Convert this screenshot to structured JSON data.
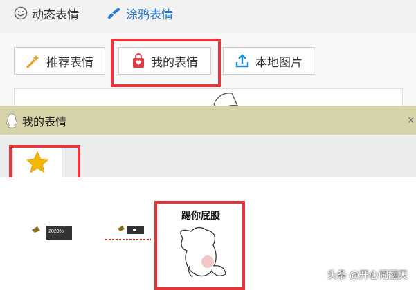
{
  "top_tabs": [
    {
      "label": "动态表情",
      "icon": "smiley-icon"
    },
    {
      "label": "涂鸦表情",
      "icon": "brush-icon"
    }
  ],
  "tool_buttons": [
    {
      "label": "推荐表情",
      "icon": "magic-wand-icon"
    },
    {
      "label": "我的表情",
      "icon": "bag-heart-icon"
    },
    {
      "label": "本地图片",
      "icon": "upload-icon"
    }
  ],
  "panel": {
    "title": "我的表情",
    "close": "×",
    "tab_icon": "star-icon"
  },
  "stickers": [
    {
      "badge": "2023%"
    },
    {
      "badge": ""
    },
    {
      "caption": "踢你屁股"
    }
  ],
  "watermark": "头条 @开心闹翻天",
  "colors": {
    "highlight": "#e8353c",
    "panel_header": "#d6d3a8",
    "link_blue": "#2a7fd4",
    "star": "#f5b800"
  }
}
